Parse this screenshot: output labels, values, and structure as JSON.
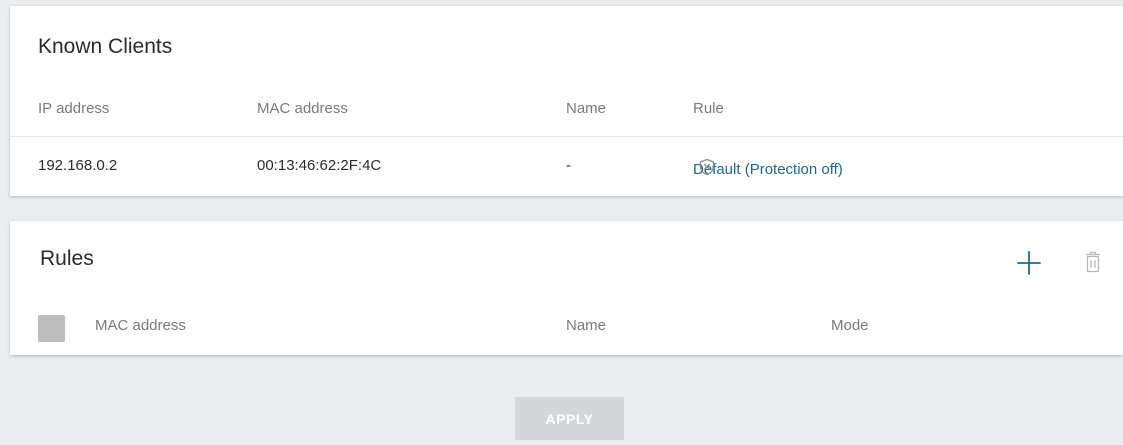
{
  "known_clients": {
    "title": "Known Clients",
    "columns": {
      "ip": "IP address",
      "mac": "MAC address",
      "name": "Name",
      "rule": "Rule"
    },
    "rows": [
      {
        "ip": "192.168.0.2",
        "mac": "00:13:46:62:2F:4C",
        "name": "-",
        "rule": "Default (Protection off)",
        "rule_icon": "shield-off-icon"
      }
    ]
  },
  "rules": {
    "title": "Rules",
    "add_icon": "plus-icon",
    "delete_icon": "trash-icon",
    "columns": {
      "mac": "MAC address",
      "name": "Name",
      "mode": "Mode"
    }
  },
  "apply_label": "APPLY",
  "colors": {
    "accent": "#1a6b8a",
    "page_background": "#e9edf0",
    "card_background": "#ffffff",
    "disabled_button": "#d3d7da",
    "checkbox": "#bdbdbd"
  }
}
